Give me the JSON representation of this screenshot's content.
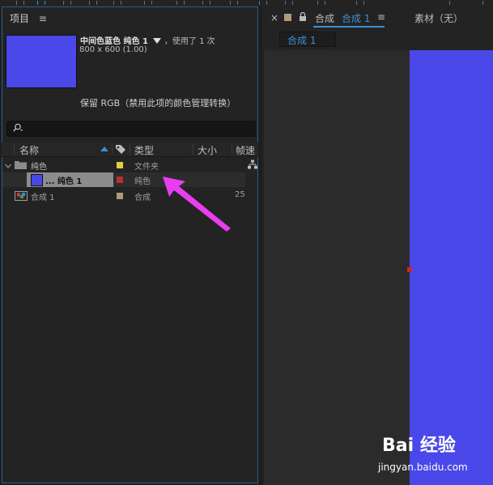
{
  "project_panel": {
    "title": "项目",
    "menu_icon": "hamburger-menu-icon",
    "preview": {
      "color": "#4a48e8",
      "name": "中间色蓝色 纯色 1",
      "used_text": "，使用了 1 次",
      "dimensions": "800 x 600 (1.00)",
      "color_note": "保留 RGB（禁用此项的颜色管理转换）"
    },
    "search": {
      "icon": "search-icon",
      "placeholder": ""
    },
    "columns": {
      "name": "名称",
      "type": "类型",
      "size": "大小",
      "frame_rate": "帧速"
    },
    "items": [
      {
        "name": "纯色",
        "type": "文件夹",
        "label_color": "#e3cf3b",
        "icon": "folder-icon",
        "frame_rate": ""
      },
      {
        "name": "... 纯色 1",
        "type": "纯色",
        "label_color": "#b63030",
        "icon": "solid-swatch-icon",
        "frame_rate": ""
      },
      {
        "name": "合成 1",
        "type": "合成",
        "label_color": "#b09a78",
        "icon": "composition-icon",
        "frame_rate": "25"
      }
    ]
  },
  "comp_panel": {
    "tab_prefix": "合成",
    "active_comp": "合成 1",
    "menu_icon": "hamburger-menu-icon",
    "footage_tab": "素材（无）",
    "breadcrumb": "合成 1",
    "solid_color": "#4a48e8"
  },
  "annotation": {
    "arrow_color": "#e83ef0"
  },
  "watermark": {
    "brand": "Bai 经验",
    "site": "jingyan.baidu.com"
  },
  "colors": {
    "accent": "#3b8fd6",
    "panel_border": "#2d5d8a"
  }
}
